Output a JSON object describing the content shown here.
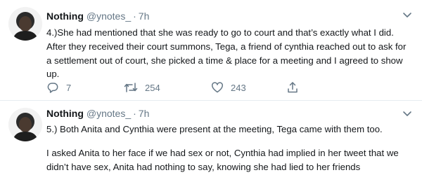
{
  "tweets": [
    {
      "name": "Nothing",
      "handle": "@ynotes_",
      "separator": "·",
      "time": "7h",
      "paragraphs": [
        "4.)She had mentioned that she was ready to go to court and that’s exactly what I did. After they received their court summons, Tega, a friend of cynthia reached out to ask for a settlement out of court, she picked a time & place for a meeting and I agreed to show up."
      ],
      "actions": {
        "reply_count": "7",
        "retweet_count": "254",
        "like_count": "243"
      }
    },
    {
      "name": "Nothing",
      "handle": "@ynotes_",
      "separator": "·",
      "time": "7h",
      "paragraphs": [
        "5.) Both Anita and Cynthia were present at the meeting, Tega came with them too.",
        "I asked Anita to her face if we had sex or not, Cynthia had implied in her tweet that we didn’t have sex, Anita had nothing to say, knowing she had lied to her friends"
      ]
    }
  ],
  "icons": {
    "caret": "chevron-down-icon",
    "reply": "reply-icon",
    "retweet": "retweet-icon",
    "like": "heart-icon",
    "share": "share-icon"
  },
  "colors": {
    "text": "#14171a",
    "secondary": "#657786",
    "divider": "#e6ecf0"
  }
}
